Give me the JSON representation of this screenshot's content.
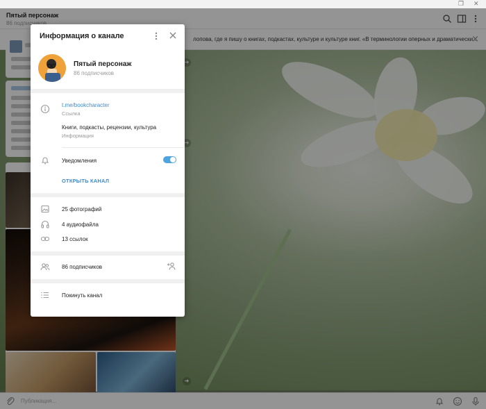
{
  "window": {
    "restore_glyph": "❐",
    "close_glyph": "✕"
  },
  "header": {
    "title": "Пятый персонаж",
    "subtitle": "86 подписчиков"
  },
  "pinned": {
    "text": "лопова, где я пишу о книгах, подкастах, культуре и культуре книг.   «В терминологии оперных и драматически..."
  },
  "composer": {
    "placeholder": "Публикация..."
  },
  "modal": {
    "title": "Информация о канале",
    "channel": {
      "name": "Пятый персонаж",
      "subscribers": "86 подписчиков"
    },
    "info": {
      "link": "t.me/bookcharacter",
      "link_caption": "Ссылка",
      "description": "Книги, подкасты, рецензии, культура",
      "description_caption": "Информация"
    },
    "notifications": {
      "label": "Уведомления",
      "enabled": true
    },
    "open_channel": "ОТКРЫТЬ КАНАЛ",
    "media": {
      "photos": "25 фотографий",
      "audio": "4 аудиофайла",
      "links": "13 ссылок"
    },
    "members": {
      "label": "86 подписчиков"
    },
    "leave": {
      "label": "Покинуть канал"
    }
  },
  "colors": {
    "accent": "#3a8ccf",
    "toggle": "#4ea4dd",
    "overlay": "rgba(0,0,0,0.42)"
  }
}
